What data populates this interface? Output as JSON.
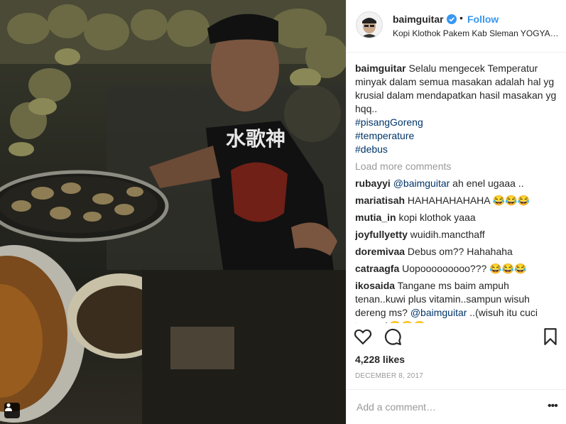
{
  "post": {
    "username": "baimguitar",
    "follow_label": "Follow",
    "dot": "•",
    "location": "Kopi Klothok Pakem Kab Sleman YOGYAKARTA",
    "caption": {
      "username": "baimguitar",
      "text": "Selalu mengecek Temperatur minyak dalam semua masakan adalah hal yg krusial dalam mendapatkan hasil masakan yg hqq..",
      "hashtags": [
        "#pisangGoreng",
        "#temperature",
        "#debus"
      ]
    },
    "load_more_label": "Load more comments",
    "comments": [
      {
        "user": "rubayyi",
        "mention": "@baimguitar",
        "text": " ah enel ugaaa .."
      },
      {
        "user": "mariatisah",
        "mention": "",
        "text": " HAHAHAHAHAHA 😂😂😂"
      },
      {
        "user": "mutia_in",
        "mention": "",
        "text": " kopi klothok yaaa"
      },
      {
        "user": "joyfullyetty",
        "mention": "",
        "text": " wuidih.mancthaff"
      },
      {
        "user": "doremivaa",
        "mention": "",
        "text": " Debus om?? Hahahaha"
      },
      {
        "user": "catraagfa",
        "mention": "",
        "text": " Uopooooooooo??? 😂😂😂"
      },
      {
        "user": "ikosaida",
        "mention": "",
        "text": " Tangane ms baim ampuh tenan..kuwi plus vitamin..sampun wisuh dereng ms? ",
        "mention_after": "@baimguitar",
        "text_after": " ..(wisuh itu cuci tangan)😁😁😁"
      }
    ],
    "likes": "4,228 likes",
    "date": "DECEMBER 8, 2017",
    "add_comment_placeholder": "Add a comment…",
    "more_label": "•••"
  },
  "icons": {
    "like": "heart-icon",
    "comment": "comment-icon",
    "save": "bookmark-icon",
    "verified": "verified-badge-icon",
    "tag": "user-tag-icon"
  },
  "colors": {
    "link": "#3897f0",
    "hashtag": "#003569",
    "muted": "#999999",
    "text": "#262626"
  }
}
